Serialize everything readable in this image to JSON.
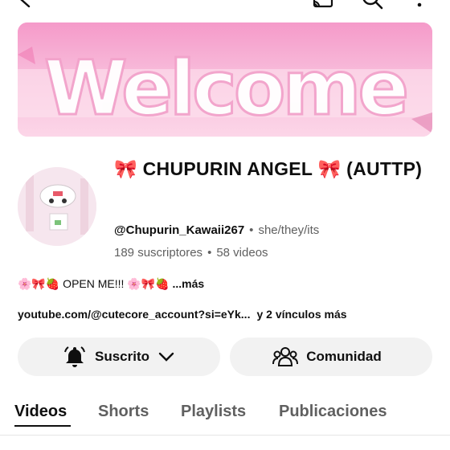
{
  "top_bar": {
    "icons": [
      "back-arrow-icon",
      "cast-icon",
      "search-icon",
      "more-vert-icon"
    ]
  },
  "banner": {
    "text": "Welcome",
    "colors": {
      "background": "#f9c2de",
      "accent": "#f07bb4",
      "text": "#ffffff"
    }
  },
  "channel": {
    "name": "🎀 CHUPURIN ANGEL 🎀 (AUTTP)",
    "handle": "@Chupurin_Kawaii267",
    "pronouns": "she/they/its",
    "subscribers": "189 suscriptores",
    "videos": "58 videos",
    "description": "🌸🎀🍓 OPEN ME!!! 🌸🎀🍓",
    "description_more": "...más",
    "link": "youtube.com/@cutecore_account?si=eYk...",
    "more_links": "y 2 vínculos más"
  },
  "actions": {
    "subscribe_label": "Suscrito",
    "community_label": "Comunidad"
  },
  "tabs": [
    "Videos",
    "Shorts",
    "Playlists",
    "Publicaciones"
  ],
  "active_tab": "Videos"
}
